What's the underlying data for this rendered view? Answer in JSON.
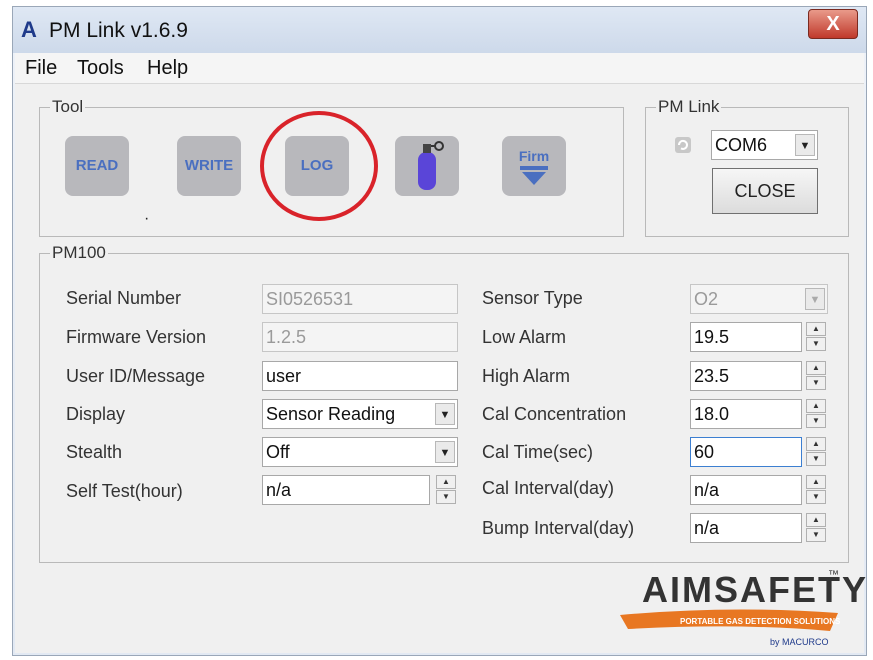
{
  "window": {
    "title": "PM Link v1.6.9",
    "app_icon_glyph": "A",
    "close_glyph": "X"
  },
  "menu": [
    "File",
    "Tools",
    "Help"
  ],
  "tool_group": {
    "title": "Tool",
    "buttons": {
      "read": "READ",
      "write": "WRITE",
      "log": "LOG",
      "firm": "Firm"
    },
    "icons": {
      "cylinder": "gas-cylinder-icon",
      "firm_arrow": "download-arrow-icon"
    },
    "highlight_color": "#d9232a"
  },
  "pm_link_group": {
    "title": "PM Link",
    "port": "COM6",
    "close_label": "CLOSE"
  },
  "pm100": {
    "title": "PM100",
    "serial_number": {
      "label": "Serial Number",
      "value": "SI0526531"
    },
    "firmware_version": {
      "label": "Firmware Version",
      "value": "1.2.5"
    },
    "user_id": {
      "label": "User ID/Message",
      "value": "user"
    },
    "display": {
      "label": "Display",
      "value": "Sensor Reading"
    },
    "stealth": {
      "label": "Stealth",
      "value": "Off"
    },
    "self_test": {
      "label": "Self Test(hour)",
      "value": "n/a"
    },
    "sensor_type": {
      "label": "Sensor Type",
      "value": "O2"
    },
    "low_alarm": {
      "label": "Low Alarm",
      "value": "19.5"
    },
    "high_alarm": {
      "label": "High Alarm",
      "value": "23.5"
    },
    "cal_concentration": {
      "label": "Cal Concentration",
      "value": "18.0"
    },
    "cal_time": {
      "label": "Cal Time(sec)",
      "value": "60"
    },
    "cal_interval": {
      "label": "Cal Interval(day)",
      "value": "n/a"
    },
    "bump_interval": {
      "label": "Bump Interval(day)",
      "value": "n/a"
    }
  },
  "brand": {
    "name": "AIMSAFETY",
    "trademark": "™",
    "tagline": "PORTABLE GAS DETECTION SOLUTIONS",
    "by": "by MACURCO",
    "accent": "#e87722"
  }
}
